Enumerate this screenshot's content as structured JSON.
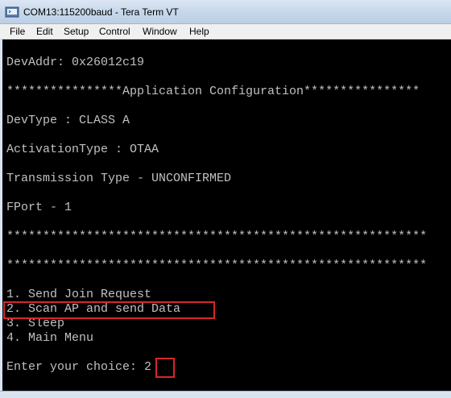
{
  "window": {
    "title": "COM13:115200baud - Tera Term VT"
  },
  "menu": [
    "File",
    "Edit",
    "Setup",
    "Control",
    "Window",
    "Help"
  ],
  "terminal": {
    "lines": [
      "DevAddr: 0x26012c19",
      "****************Application Configuration****************",
      "DevType : CLASS A",
      "ActivationType : OTAA",
      "Transmission Type - UNCONFIRMED",
      "FPort - 1",
      "**********************************************************",
      "**********************************************************",
      "1. Send Join Request",
      "2. Scan AP and send Data",
      "3. Sleep",
      "4. Main Menu",
      "Enter your choice: 2"
    ]
  },
  "colors": {
    "highlight": "#d9262b",
    "terminal_bg": "#000000",
    "terminal_text": "#c0c0c0"
  }
}
